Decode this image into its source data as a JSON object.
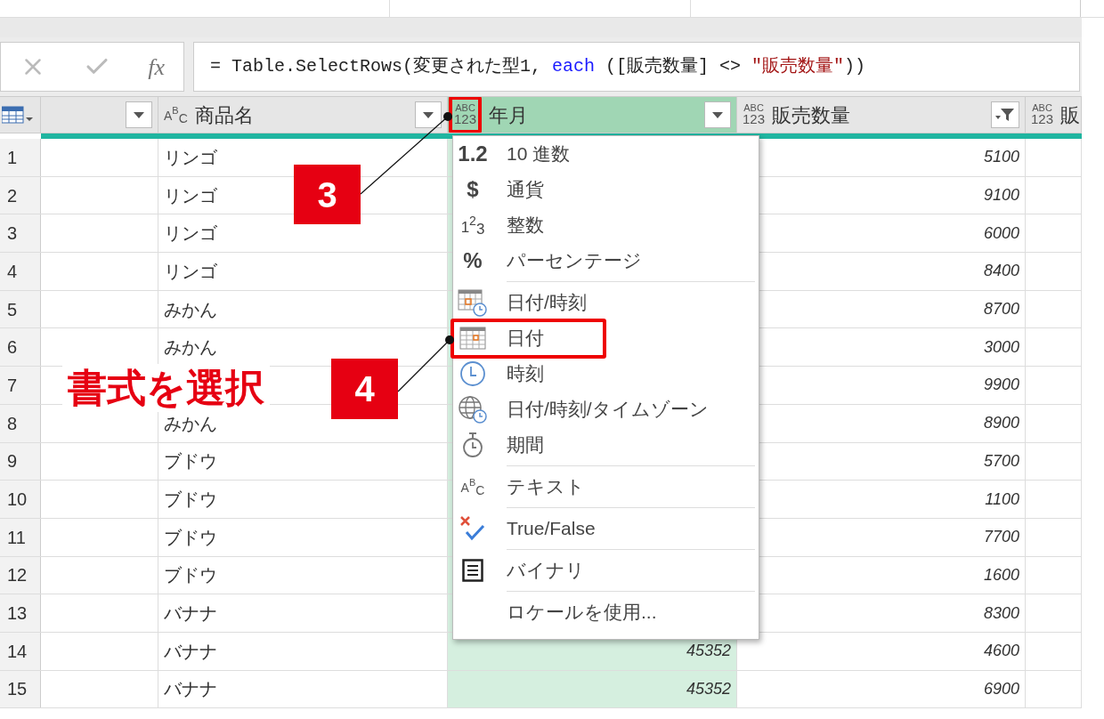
{
  "formula_bar": {
    "fx_label": "fx",
    "tokens": [
      {
        "kind": "plain",
        "text": "= Table.SelectRows(変更された型1, "
      },
      {
        "kind": "keyword",
        "text": "each"
      },
      {
        "kind": "plain",
        "text": " ([販売数量] <> "
      },
      {
        "kind": "string",
        "text": "\"販売数量\""
      },
      {
        "kind": "plain",
        "text": "))"
      }
    ]
  },
  "columns": [
    {
      "type": {
        "kind": "none"
      },
      "button": {
        "kind": "dropdown"
      },
      "selected": false
    },
    {
      "name": "商品名",
      "type": {
        "kind": "abc",
        "glyphs": [
          "A",
          "B",
          "C"
        ]
      },
      "button": {
        "kind": "dropdown"
      },
      "selected": false,
      "callout": false
    },
    {
      "name": "年月",
      "type": {
        "kind": "abc123",
        "glyphs": [
          "ABC",
          "123"
        ]
      },
      "button": {
        "kind": "dropdown"
      },
      "selected": true,
      "callout": true
    },
    {
      "name": "販売数量",
      "type": {
        "kind": "abc123",
        "glyphs": [
          "ABC",
          "123"
        ]
      },
      "button": {
        "kind": "filter"
      },
      "selected": false,
      "callout": false
    },
    {
      "name": "販",
      "type": {
        "kind": "abc123",
        "glyphs": [
          "ABC",
          "123"
        ]
      },
      "selected": false,
      "callout": false
    }
  ],
  "rows": [
    {
      "number": "1",
      "cells": [
        "",
        "リンゴ",
        "",
        "5100",
        ""
      ]
    },
    {
      "number": "2",
      "cells": [
        "",
        "リンゴ",
        "",
        "9100",
        ""
      ]
    },
    {
      "number": "3",
      "cells": [
        "",
        "リンゴ",
        "",
        "6000",
        ""
      ]
    },
    {
      "number": "4",
      "cells": [
        "",
        "リンゴ",
        "",
        "8400",
        ""
      ]
    },
    {
      "number": "5",
      "cells": [
        "",
        "みかん",
        "",
        "8700",
        ""
      ]
    },
    {
      "number": "6",
      "cells": [
        "",
        "みかん",
        "",
        "3000",
        ""
      ]
    },
    {
      "number": "7",
      "cells": [
        "",
        "",
        "",
        "9900",
        ""
      ]
    },
    {
      "number": "8",
      "cells": [
        "",
        "みかん",
        "",
        "8900",
        ""
      ]
    },
    {
      "number": "9",
      "cells": [
        "",
        "ブドウ",
        "",
        "5700",
        ""
      ]
    },
    {
      "number": "10",
      "cells": [
        "",
        "ブドウ",
        "",
        "1100",
        ""
      ]
    },
    {
      "number": "11",
      "cells": [
        "",
        "ブドウ",
        "",
        "7700",
        ""
      ]
    },
    {
      "number": "12",
      "cells": [
        "",
        "ブドウ",
        "",
        "1600",
        ""
      ]
    },
    {
      "number": "13",
      "cells": [
        "",
        "バナナ",
        "",
        "8300",
        ""
      ]
    },
    {
      "number": "14",
      "cells": [
        "",
        "バナナ",
        "45352",
        "4600",
        ""
      ]
    },
    {
      "number": "15",
      "cells": [
        "",
        "バナナ",
        "45352",
        "6900",
        ""
      ]
    }
  ],
  "type_menu": [
    {
      "kind": "item",
      "label": "10 進数",
      "icon": {
        "kind": "glyph",
        "glyphs": [
          "1.2"
        ]
      },
      "callout": false
    },
    {
      "kind": "item",
      "label": "通貨",
      "icon": {
        "kind": "glyph",
        "glyphs": [
          "$"
        ]
      },
      "callout": false
    },
    {
      "kind": "item",
      "label": "整数",
      "icon": {
        "kind": "superscript",
        "glyphs": [
          "1",
          "2",
          "3"
        ]
      },
      "callout": false
    },
    {
      "kind": "item",
      "label": "パーセンテージ",
      "icon": {
        "kind": "glyph",
        "glyphs": [
          "%"
        ]
      },
      "callout": false
    },
    {
      "kind": "separator"
    },
    {
      "kind": "item",
      "label": "日付/時刻",
      "icon": {
        "kind": "datetime"
      },
      "callout": false
    },
    {
      "kind": "item",
      "label": "日付",
      "icon": {
        "kind": "date"
      },
      "callout": true
    },
    {
      "kind": "item",
      "label": "時刻",
      "icon": {
        "kind": "time"
      },
      "callout": false
    },
    {
      "kind": "item",
      "label": "日付/時刻/タイムゾーン",
      "icon": {
        "kind": "timezone"
      },
      "callout": false
    },
    {
      "kind": "item",
      "label": "期間",
      "icon": {
        "kind": "duration"
      },
      "callout": false
    },
    {
      "kind": "separator"
    },
    {
      "kind": "item",
      "label": "テキスト",
      "icon": {
        "kind": "abc",
        "glyphs": [
          "A",
          "B",
          "C"
        ]
      },
      "callout": false
    },
    {
      "kind": "separator"
    },
    {
      "kind": "item",
      "label": "True/False",
      "icon": {
        "kind": "truefalse"
      },
      "callout": false
    },
    {
      "kind": "separator"
    },
    {
      "kind": "item",
      "label": "バイナリ",
      "icon": {
        "kind": "binary"
      },
      "callout": false
    },
    {
      "kind": "separator"
    },
    {
      "kind": "item",
      "label": "ロケールを使用...",
      "icon": {
        "kind": "none"
      },
      "callout": false
    }
  ],
  "callouts": [
    {
      "number": "3"
    },
    {
      "number": "4"
    }
  ],
  "caption": "書式を選択"
}
